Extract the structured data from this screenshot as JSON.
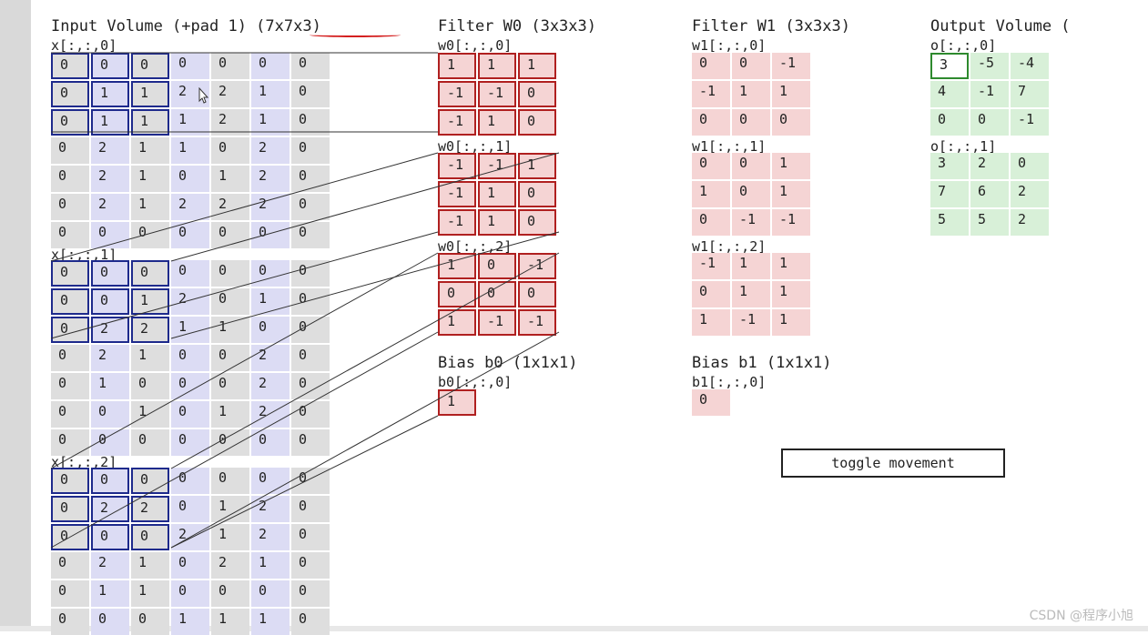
{
  "titles": {
    "input": "Input Volume (+pad 1) (7x7x3)",
    "filter_w0": "Filter W0 (3x3x3)",
    "filter_w1": "Filter W1 (3x3x3)",
    "output": "Output Volume ("
  },
  "input_slices": [
    {
      "label": "x[:,:,0]",
      "rows": [
        [
          "0",
          "0",
          "0",
          "0",
          "0",
          "0",
          "0"
        ],
        [
          "0",
          "1",
          "1",
          "2",
          "2",
          "1",
          "0"
        ],
        [
          "0",
          "1",
          "1",
          "1",
          "2",
          "1",
          "0"
        ],
        [
          "0",
          "2",
          "1",
          "1",
          "0",
          "2",
          "0"
        ],
        [
          "0",
          "2",
          "1",
          "0",
          "1",
          "2",
          "0"
        ],
        [
          "0",
          "2",
          "1",
          "2",
          "2",
          "2",
          "0"
        ],
        [
          "0",
          "0",
          "0",
          "0",
          "0",
          "0",
          "0"
        ]
      ]
    },
    {
      "label": "x[:,:,1]",
      "rows": [
        [
          "0",
          "0",
          "0",
          "0",
          "0",
          "0",
          "0"
        ],
        [
          "0",
          "0",
          "1",
          "2",
          "0",
          "1",
          "0"
        ],
        [
          "0",
          "2",
          "2",
          "1",
          "1",
          "0",
          "0"
        ],
        [
          "0",
          "2",
          "1",
          "0",
          "0",
          "2",
          "0"
        ],
        [
          "0",
          "1",
          "0",
          "0",
          "0",
          "2",
          "0"
        ],
        [
          "0",
          "0",
          "1",
          "0",
          "1",
          "2",
          "0"
        ],
        [
          "0",
          "0",
          "0",
          "0",
          "0",
          "0",
          "0"
        ]
      ]
    },
    {
      "label": "x[:,:,2]",
      "rows": [
        [
          "0",
          "0",
          "0",
          "0",
          "0",
          "0",
          "0"
        ],
        [
          "0",
          "2",
          "2",
          "0",
          "1",
          "2",
          "0"
        ],
        [
          "0",
          "0",
          "0",
          "2",
          "1",
          "2",
          "0"
        ],
        [
          "0",
          "2",
          "1",
          "0",
          "2",
          "1",
          "0"
        ],
        [
          "0",
          "1",
          "1",
          "0",
          "0",
          "0",
          "0"
        ],
        [
          "0",
          "0",
          "0",
          "1",
          "1",
          "1",
          "0"
        ]
      ]
    }
  ],
  "w0_slices": [
    {
      "label": "w0[:,:,0]",
      "rows": [
        [
          "1",
          "1",
          "1"
        ],
        [
          "-1",
          "-1",
          "0"
        ],
        [
          "-1",
          "1",
          "0"
        ]
      ]
    },
    {
      "label": "w0[:,:,1]",
      "rows": [
        [
          "-1",
          "-1",
          "1"
        ],
        [
          "-1",
          "1",
          "0"
        ],
        [
          "-1",
          "1",
          "0"
        ]
      ]
    },
    {
      "label": "w0[:,:,2]",
      "rows": [
        [
          "1",
          "0",
          "-1"
        ],
        [
          "0",
          "0",
          "0"
        ],
        [
          "1",
          "-1",
          "-1"
        ]
      ]
    }
  ],
  "w1_slices": [
    {
      "label": "w1[:,:,0]",
      "rows": [
        [
          "0",
          "0",
          "-1"
        ],
        [
          "-1",
          "1",
          "1"
        ],
        [
          "0",
          "0",
          "0"
        ]
      ]
    },
    {
      "label": "w1[:,:,1]",
      "rows": [
        [
          "0",
          "0",
          "1"
        ],
        [
          "1",
          "0",
          "1"
        ],
        [
          "0",
          "-1",
          "-1"
        ]
      ]
    },
    {
      "label": "w1[:,:,2]",
      "rows": [
        [
          "-1",
          "1",
          "1"
        ],
        [
          "0",
          "1",
          "1"
        ],
        [
          "1",
          "-1",
          "1"
        ]
      ]
    }
  ],
  "output_slices": [
    {
      "label": "o[:,:,0]",
      "rows": [
        [
          "3",
          "-5",
          "-4"
        ],
        [
          "4",
          "-1",
          "7"
        ],
        [
          "0",
          "0",
          "-1"
        ]
      ]
    },
    {
      "label": "o[:,:,1]",
      "rows": [
        [
          "3",
          "2",
          "0"
        ],
        [
          "7",
          "6",
          "2"
        ],
        [
          "5",
          "5",
          "2"
        ]
      ]
    }
  ],
  "bias0": {
    "title": "Bias b0 (1x1x1)",
    "label": "b0[:,:,0]",
    "value": "1"
  },
  "bias1": {
    "title": "Bias b1 (1x1x1)",
    "label": "b1[:,:,0]",
    "value": "0"
  },
  "toggle_label": "toggle movement",
  "watermark": "CSDN @程序小旭",
  "colors": {
    "input_cell_a": "#dedede",
    "input_cell_b": "#dcdcf4",
    "input_highlight": "#1e2a8c",
    "filter_cell": "#f5d4d4",
    "filter_highlight": "#b02020",
    "output_cell": "#d8f0d8",
    "output_highlight": "#2e8a2e",
    "annotation_underline": "#d42020"
  }
}
